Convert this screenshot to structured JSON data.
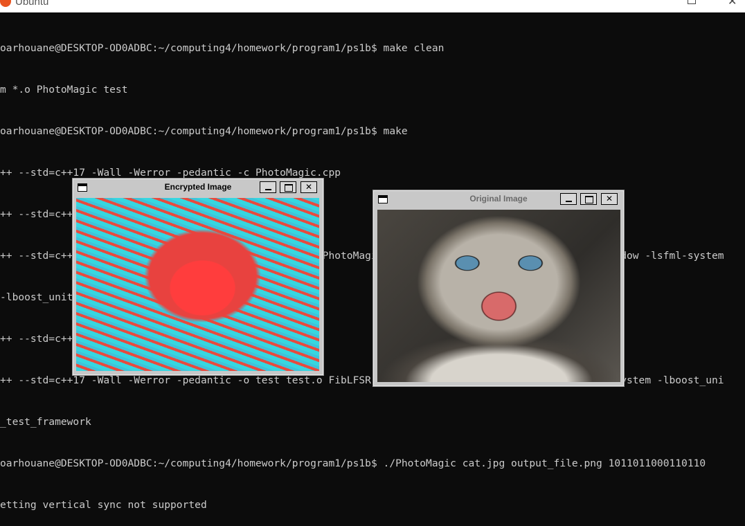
{
  "titlebar": {
    "app_title": "Ubuntu"
  },
  "terminal": {
    "lines": [
      "oarhouane@DESKTOP-OD0ADBC:~/computing4/homework/program1/ps1b$ make clean",
      "m *.o PhotoMagic test",
      "oarhouane@DESKTOP-OD0ADBC:~/computing4/homework/program1/ps1b$ make",
      "++ --std=c++17 -Wall -Werror -pedantic -c PhotoMagic.cpp",
      "++ --std=c++17 -Wall -Werror -pedantic -c FibLFSR.cpp",
      "++ --std=c++17 -Wall -Werror -pedantic -o PhotoMagic PhotoMagic.o FibLFSR.o -lsfml-graphics -lsfml-window -lsfml-system",
      "-lboost_unit_test_framework",
      "++ --std=c++17 -Wall -Werror -pedantic -c test.cpp",
      "++ --std=c++17 -Wall -Werror -pedantic -o test test.o FibLFSR.o -lsfml-graphics -lsfml-window -lsfml-system -lboost_uni",
      "_test_framework",
      "oarhouane@DESKTOP-OD0ADBC:~/computing4/homework/program1/ps1b$ ./PhotoMagic cat.jpg output_file.png 1011011000110110",
      "etting vertical sync not supported"
    ]
  },
  "windows": {
    "encrypted": {
      "title": "Encrypted Image",
      "min_label": "",
      "max_label": "",
      "close_label": "✕"
    },
    "original": {
      "title": "Original Image",
      "min_label": "",
      "max_label": "",
      "close_label": "✕"
    }
  },
  "colors": {
    "terminal_bg": "#0c0c0c",
    "terminal_fg": "#cccccc",
    "active_title": "#000000",
    "inactive_title": "#6a6a6a"
  },
  "icons": {
    "app": "ubuntu-icon",
    "window_menu": "window-menu-icon",
    "minimize": "minimize-icon",
    "maximize": "maximize-icon",
    "close": "close-icon"
  }
}
